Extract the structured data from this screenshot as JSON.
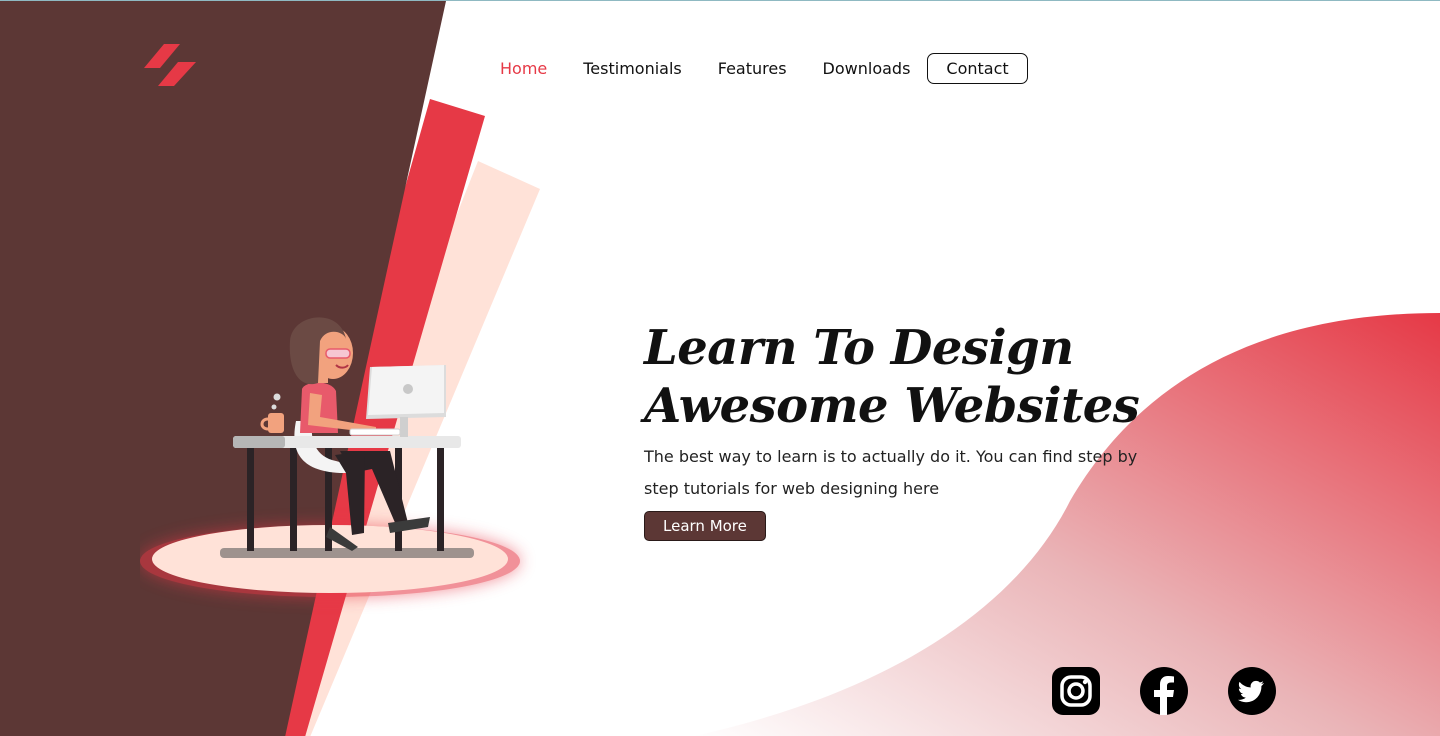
{
  "colors": {
    "brown": "#5c3735",
    "red": "#e63946",
    "peach": "#ffe2d8",
    "text": "#111111",
    "nav_active": "#e63946"
  },
  "logo": {
    "icon": "logo-slash-icon"
  },
  "nav": {
    "items": [
      {
        "label": "Home",
        "active": true
      },
      {
        "label": "Testimonials",
        "active": false
      },
      {
        "label": "Features",
        "active": false
      },
      {
        "label": "Downloads",
        "active": false
      }
    ],
    "contact_label": "Contact"
  },
  "hero": {
    "title_line1": "Learn To Design",
    "title_line2": "Awesome Websites",
    "subtitle": "The best way to learn is to actually do it. You can find step by step tutorials for web designing here",
    "cta_label": "Learn More"
  },
  "illustration": {
    "icon": "girl-at-desk-illustration"
  },
  "socials": [
    {
      "icon": "instagram-icon"
    },
    {
      "icon": "facebook-icon"
    },
    {
      "icon": "twitter-icon"
    }
  ]
}
